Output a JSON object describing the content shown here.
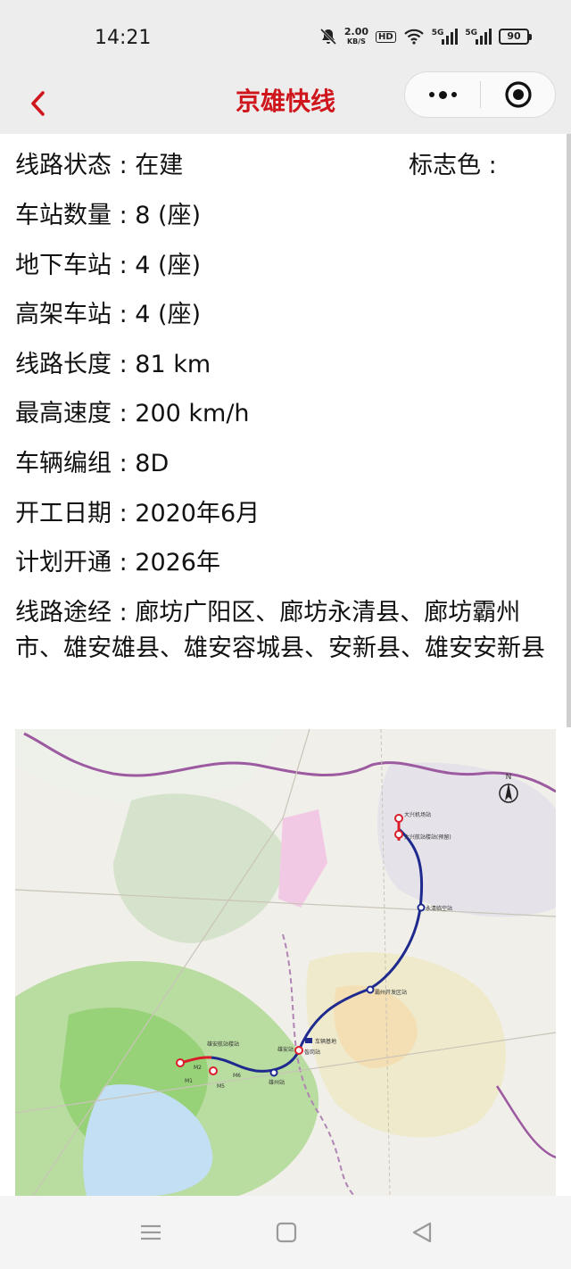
{
  "status": {
    "time": "14:21",
    "speed_value": "2.00",
    "speed_unit": "KB/S",
    "hd": "HD",
    "sig1": "5G",
    "sig2": "5G",
    "battery": "90"
  },
  "header": {
    "title": "京雄快线"
  },
  "info": {
    "status": "线路状态 : 在建",
    "logo_color": "标志色 :",
    "stations": "车站数量 : 8 (座)",
    "underground": "地下车站 : 4 (座)",
    "elevated": "高架车站 : 4 (座)",
    "length": "线路长度 : 81 km",
    "speed": "最高速度 : 200 km/h",
    "formation": "车辆编组 : 8D",
    "start": "开工日期 : 2020年6月",
    "opening": "计划开通 : 2026年",
    "route": "线路途经 : 廊坊广阳区、廊坊永清县、廊坊霸州市、雄安雄县、雄安容城县、安新县、雄安安新县"
  },
  "map": {
    "compass": "N",
    "labels": [
      "大兴机场站",
      "大兴航站楼站(预留)",
      "永清临空站",
      "霸州开发区站",
      "车辆基地",
      "雄安站",
      "昝岗站",
      "雄州站",
      "雄安航站楼站",
      "M1",
      "M2",
      "M5",
      "M6"
    ]
  },
  "colors": {
    "accent": "#d0161d",
    "line_blue": "#1f2a8f",
    "line_red": "#d91e2a"
  }
}
